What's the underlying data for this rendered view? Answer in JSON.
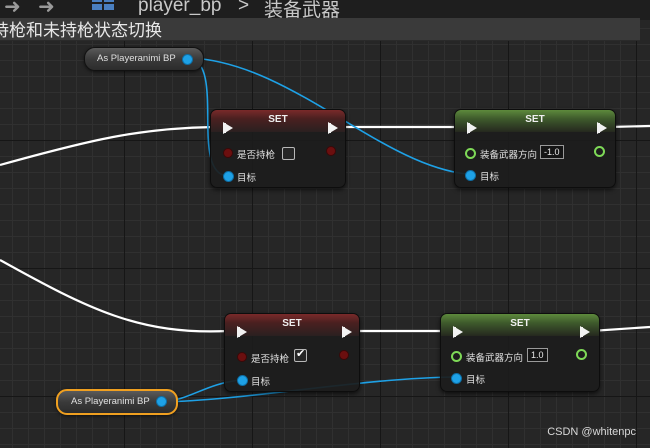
{
  "breadcrumb": {
    "blueprint_name": "player_bp",
    "separator": ">",
    "graph_name": "装备武器"
  },
  "comment": {
    "text": "持枪和未持枪状态切换"
  },
  "nodes": {
    "var_top": {
      "label": "As Playeranimi BP"
    },
    "var_bottom": {
      "label": "As Playeranimi BP"
    },
    "set1": {
      "title": "SET",
      "bool_label": "是否持枪",
      "bool_checked": false,
      "target_label": "目标"
    },
    "set2": {
      "title": "SET",
      "float_label": "装备武器方向",
      "float_value": "-1.0",
      "target_label": "目标"
    },
    "set3": {
      "title": "SET",
      "bool_label": "是否持枪",
      "bool_checked": true,
      "target_label": "目标",
      "check_glyph": "✔"
    },
    "set4": {
      "title": "SET",
      "float_label": "装备武器方向",
      "float_value": "1.0",
      "target_label": "目标"
    }
  },
  "colors": {
    "exec_wire": "#ffffff",
    "object_wire": "#1ea1e6",
    "bool_pin": "#6b0f0f",
    "float_pin": "#7ed957",
    "selected_border": "#f0a020"
  },
  "watermark": "CSDN @whitenpc"
}
